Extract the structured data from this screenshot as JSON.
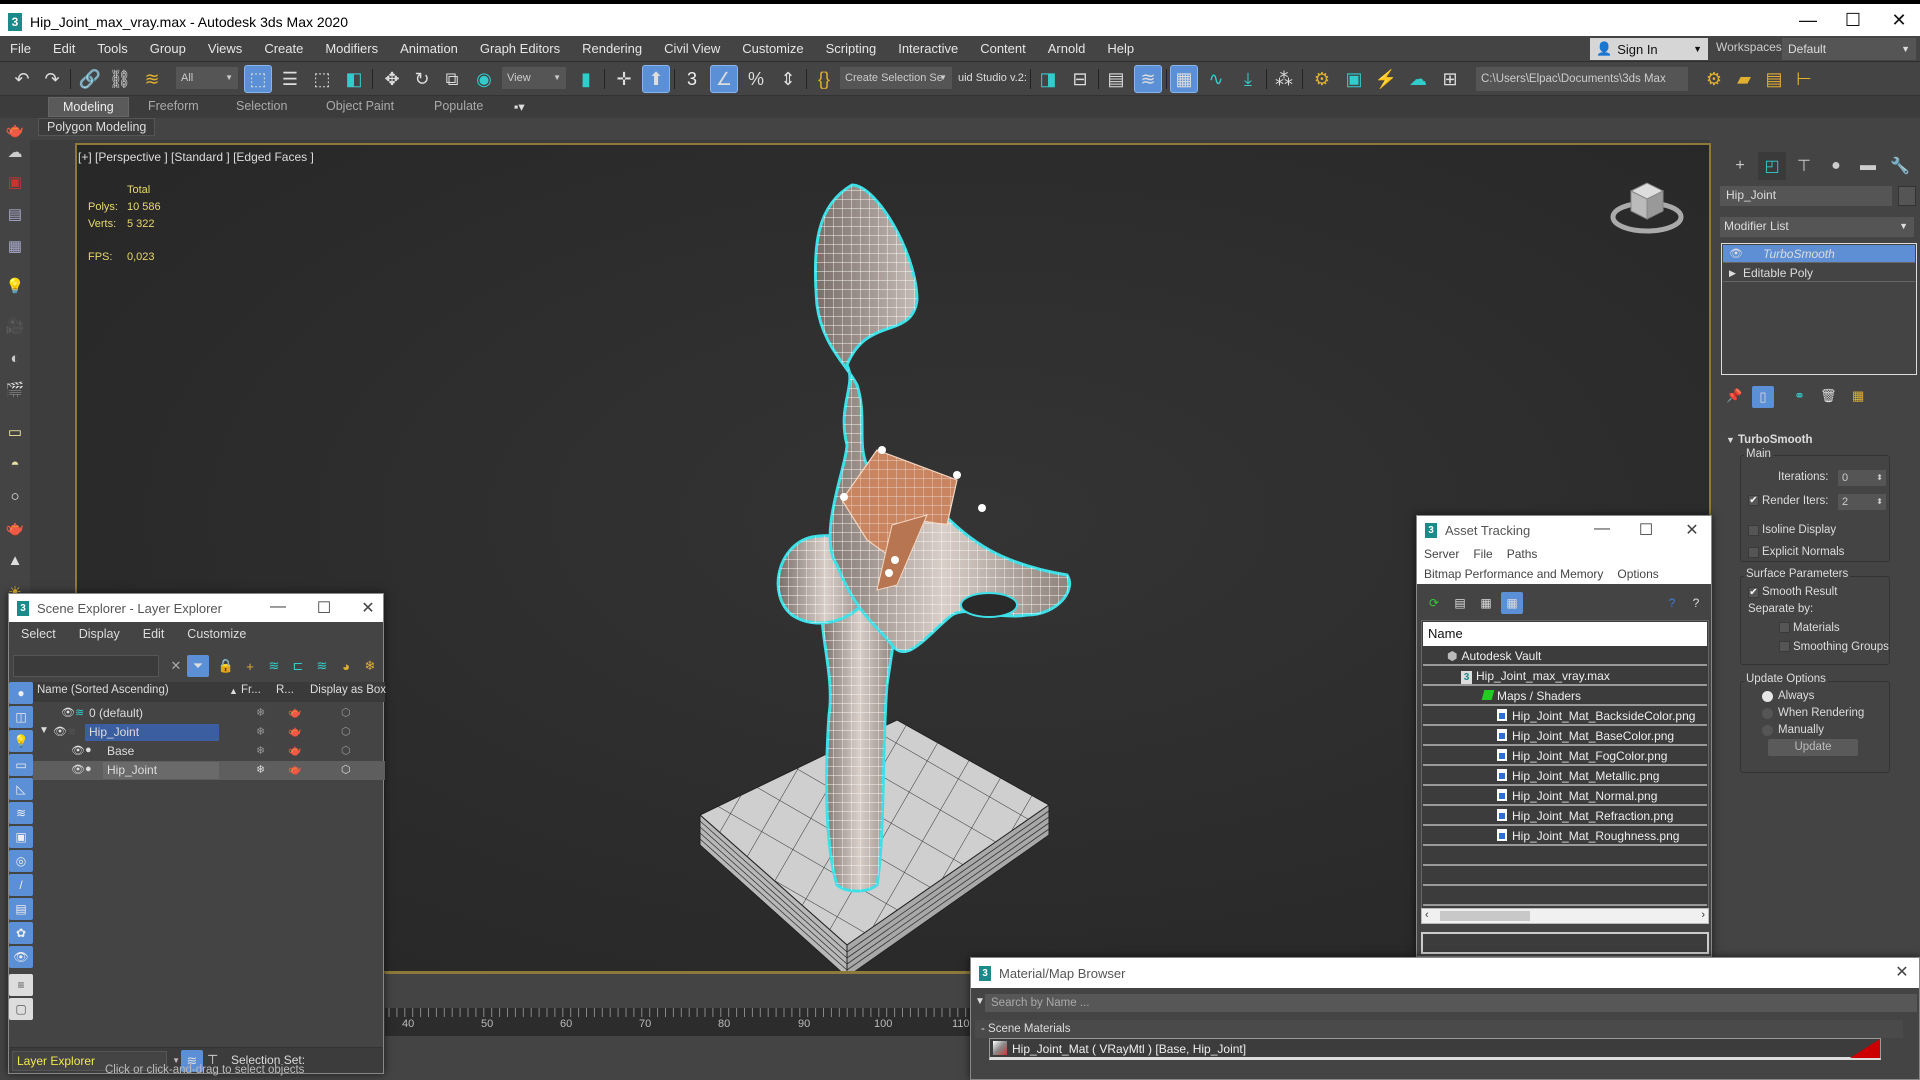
{
  "window": {
    "title": "Hip_Joint_max_vray.max - Autodesk 3ds Max 2020",
    "controls": {
      "minimize": "—",
      "maximize": "☐",
      "close": "✕"
    }
  },
  "menubar": {
    "items": [
      "File",
      "Edit",
      "Tools",
      "Group",
      "Views",
      "Create",
      "Modifiers",
      "Animation",
      "Graph Editors",
      "Rendering",
      "Civil View",
      "Customize",
      "Scripting",
      "Interactive",
      "Content",
      "Arnold",
      "Help"
    ],
    "sign_in": "Sign In",
    "workspaces_label": "Workspaces:",
    "workspace_value": "Default"
  },
  "toolbar": {
    "selection_filter": "All",
    "reference_coord": "View",
    "selection_set": "Create Selection Se",
    "fluid_studio_text": "uid Studio v.2:",
    "project_path": "C:\\Users\\Elpac\\Documents\\3ds Max 2020"
  },
  "ribbon": {
    "tabs": [
      "Modeling",
      "Freeform",
      "Selection",
      "Object Paint",
      "Populate"
    ],
    "active_tab": "Modeling",
    "sub_panel": "Polygon Modeling"
  },
  "viewport": {
    "label": "[+] [Perspective ] [Standard ] [Edged Faces ]",
    "stats": {
      "header": "Total",
      "polys_label": "Polys:",
      "polys_value": "10 586",
      "verts_label": "Verts:",
      "verts_value": "5 322",
      "fps_label": "FPS:",
      "fps_value": "0,023"
    }
  },
  "command_panel": {
    "object_name": "Hip_Joint",
    "modifier_list": "Modifier List",
    "modifier_stack": [
      "TurboSmooth",
      "Editable Poly"
    ],
    "selected_modifier": "TurboSmooth",
    "turbosmooth": {
      "title": "TurboSmooth",
      "main_group": "Main",
      "iterations_label": "Iterations:",
      "iterations_value": "0",
      "render_iters_label": "Render Iters:",
      "render_iters_value": "2",
      "render_iters_checked": true,
      "isoline_label": "Isoline Display",
      "isoline_checked": false,
      "explicit_normals_label": "Explicit Normals",
      "explicit_normals_checked": false,
      "surface_group": "Surface Parameters",
      "smooth_result_label": "Smooth Result",
      "smooth_result_checked": true,
      "separate_by_label": "Separate by:",
      "materials_label": "Materials",
      "smoothing_groups_label": "Smoothing Groups",
      "update_group": "Update Options",
      "update_options": [
        "Always",
        "When Rendering",
        "Manually"
      ],
      "update_selected": "Always",
      "update_button": "Update"
    }
  },
  "scene_explorer": {
    "title": "Scene Explorer - Layer Explorer",
    "menu": [
      "Select",
      "Display",
      "Edit",
      "Customize"
    ],
    "columns": [
      "Name (Sorted Ascending)",
      "Fr...",
      "R...",
      "Display as Box"
    ],
    "rows": [
      {
        "name": "0 (default)",
        "level": 0
      },
      {
        "name": "Hip_Joint",
        "level": 0,
        "expanded": true,
        "selected": true
      },
      {
        "name": "Base",
        "level": 1
      },
      {
        "name": "Hip_Joint",
        "level": 1,
        "highlighted": true
      }
    ],
    "explorer_select": "Layer Explorer",
    "selection_set_label": "Selection Set:",
    "status": "Click or click-and-drag to select objects"
  },
  "timeline": {
    "ticks": [
      "40",
      "50",
      "60",
      "70",
      "80",
      "90",
      "100",
      "110"
    ]
  },
  "asset_tracking": {
    "title": "Asset Tracking",
    "menu_row1": [
      "Server",
      "File",
      "Paths"
    ],
    "menu_row2": [
      "Bitmap Performance and Memory",
      "Options"
    ],
    "column": "Name",
    "tree": [
      {
        "name": "Autodesk Vault",
        "level": 0,
        "icon": "vault-icon"
      },
      {
        "name": "Hip_Joint_max_vray.max",
        "level": 1,
        "icon": "max-file-icon"
      },
      {
        "name": "Maps / Shaders",
        "level": 2,
        "icon": "maps-icon"
      },
      {
        "name": "Hip_Joint_Mat_BacksideColor.png",
        "level": 3,
        "icon": "image-file-icon"
      },
      {
        "name": "Hip_Joint_Mat_BaseColor.png",
        "level": 3,
        "icon": "image-file-icon"
      },
      {
        "name": "Hip_Joint_Mat_FogColor.png",
        "level": 3,
        "icon": "image-file-icon"
      },
      {
        "name": "Hip_Joint_Mat_Metallic.png",
        "level": 3,
        "icon": "image-file-icon"
      },
      {
        "name": "Hip_Joint_Mat_Normal.png",
        "level": 3,
        "icon": "image-file-icon"
      },
      {
        "name": "Hip_Joint_Mat_Refraction.png",
        "level": 3,
        "icon": "image-file-icon"
      },
      {
        "name": "Hip_Joint_Mat_Roughness.png",
        "level": 3,
        "icon": "image-file-icon"
      }
    ]
  },
  "material_browser": {
    "title": "Material/Map Browser",
    "search_placeholder": "Search by Name ...",
    "category": "- Scene Materials",
    "item": "Hip_Joint_Mat ( VRayMtl ) [Base, Hip_Joint]"
  },
  "colors": {
    "accent_blue": "#5b8fd6",
    "selection_outline": "#3ee0e8",
    "viewport_border": "#8d7a3a",
    "stats_text": "#e8d86a"
  }
}
